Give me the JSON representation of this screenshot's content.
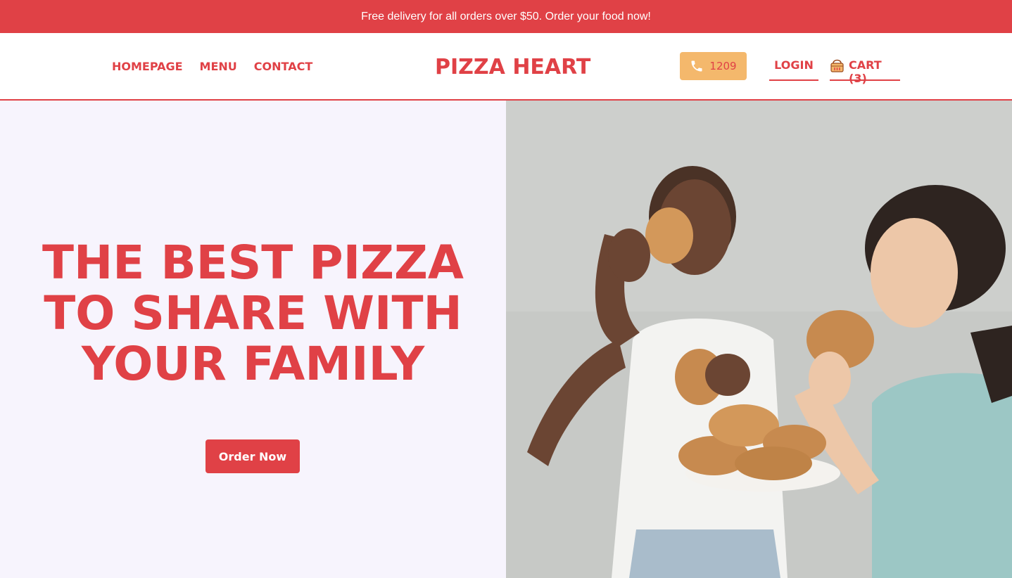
{
  "promo": {
    "text": "Free delivery for all orders over $50. Order your food now!"
  },
  "nav": {
    "items": [
      "HOMEPAGE",
      "MENU",
      "CONTACT"
    ]
  },
  "brand": {
    "name": "PIZZA HEART"
  },
  "contact": {
    "phone_icon": "phone-icon",
    "number": "1209"
  },
  "account": {
    "login_label": "LOGIN"
  },
  "cart": {
    "icon": "basket-icon",
    "label": "CART (3)"
  },
  "hero": {
    "title_lines": [
      "THE BEST PIZZA",
      "TO SHARE WITH",
      "YOUR FAMILY"
    ],
    "cta_label": "Order Now"
  },
  "colors": {
    "brand_red": "#e04146",
    "phone_button": "#f4b86c",
    "hero_background": "#f7f4fd"
  }
}
